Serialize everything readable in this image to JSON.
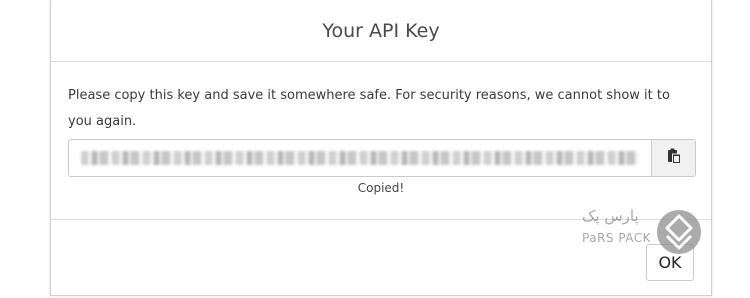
{
  "dialog": {
    "title": "Your API Key",
    "message": "Please copy this key and save it somewhere safe. For security reasons, we cannot show it to you again.",
    "copy_icon": "clipboard-icon",
    "status": "Copied!",
    "ok_label": "OK"
  },
  "watermark": {
    "text_fa": "پارس پک",
    "text_en": "PaRS PACK",
    "logo_icon": "parspack-logo-icon"
  },
  "colors": {
    "border": "#cfcfcf",
    "button_bg": "#f1f1f1",
    "text": "#333333"
  }
}
